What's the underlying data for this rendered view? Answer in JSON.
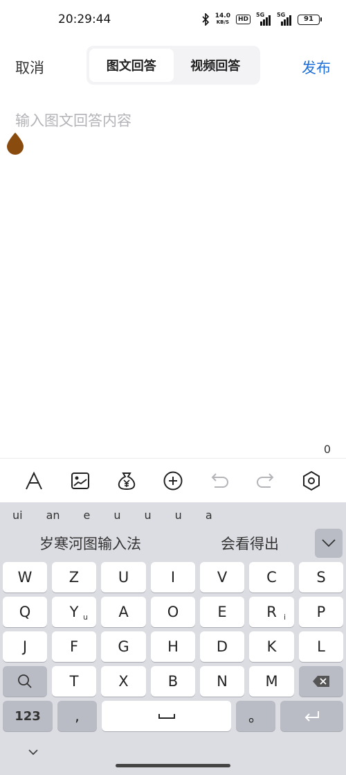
{
  "status_bar": {
    "time": "20:29:44",
    "net_speed_value": "14.0",
    "net_speed_unit": "KB/S",
    "hd_label": "HD",
    "sim1_label": "5G",
    "sim2_label": "5G",
    "battery": "91"
  },
  "header": {
    "cancel_label": "取消",
    "tabs": [
      {
        "label": "图文回答",
        "active": true
      },
      {
        "label": "视频回答",
        "active": false
      }
    ],
    "publish_label": "发布",
    "publish_color": "#1e6fd9"
  },
  "editor": {
    "value": "",
    "placeholder": "输入图文回答内容",
    "char_count": "0",
    "cursor_handle_color": "#8a4b0f"
  },
  "toolbar": {
    "icons": [
      "text-format-icon",
      "image-icon",
      "money-bag-icon",
      "add-circle-icon",
      "undo-icon",
      "redo-icon",
      "settings-icon"
    ]
  },
  "keyboard": {
    "pinyin": [
      "ui",
      "an",
      "e",
      "u",
      "u",
      "u",
      "a"
    ],
    "candidates": [
      "岁寒河图输入法",
      "会看得出"
    ],
    "row1": [
      "W",
      "Z",
      "U",
      "I",
      "V",
      "C",
      "S"
    ],
    "row2": [
      "Q",
      "Y",
      "A",
      "O",
      "E",
      "R",
      "P"
    ],
    "row2_subs": {
      "y": "u",
      "r": "i"
    },
    "row3": [
      "J",
      "F",
      "G",
      "H",
      "D",
      "K",
      "L"
    ],
    "row4": [
      "T",
      "X",
      "B",
      "N",
      "M"
    ],
    "num_label": "123",
    "comma_label": ",",
    "period_label": "。"
  }
}
